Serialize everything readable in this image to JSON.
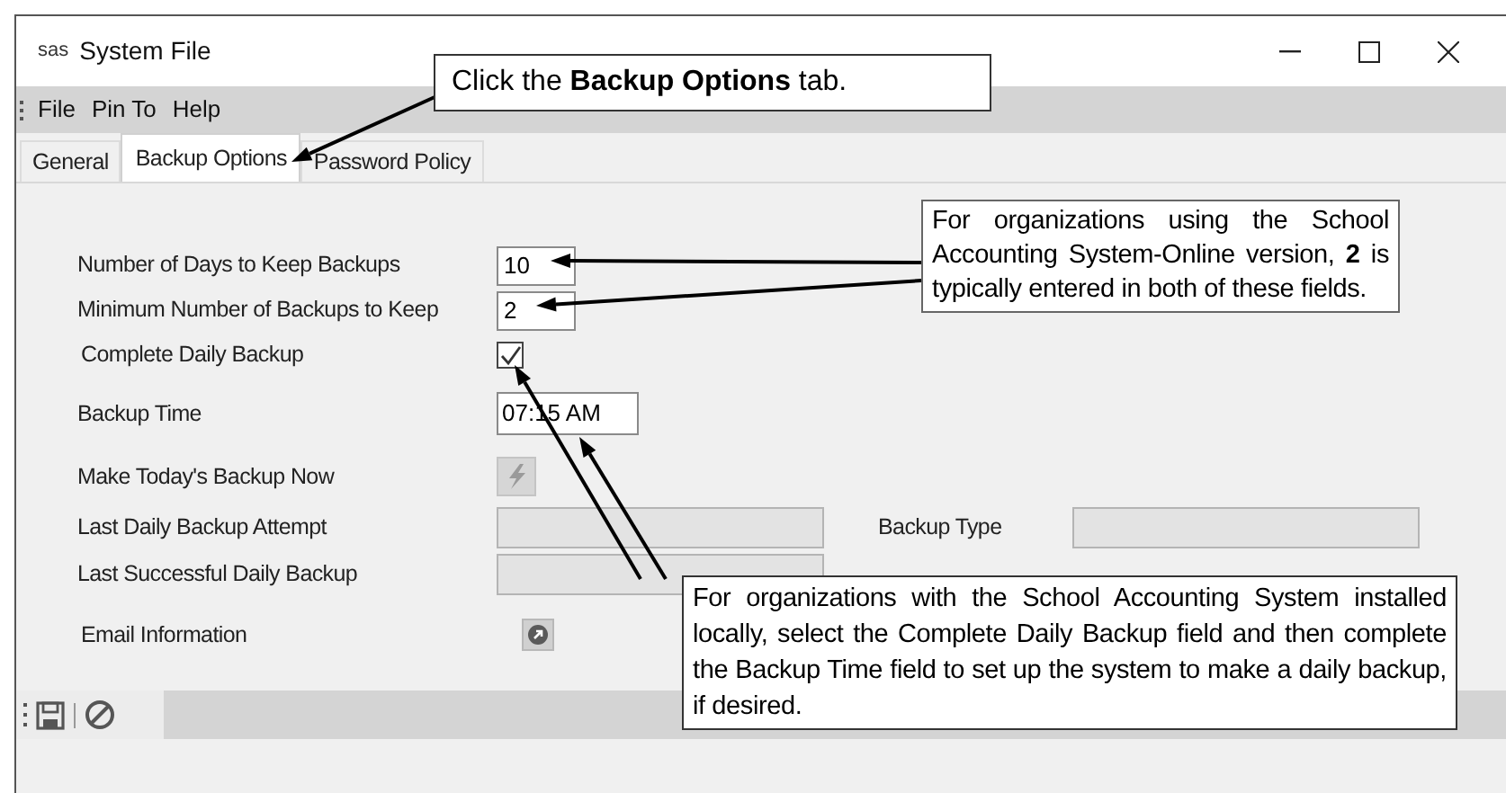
{
  "window": {
    "app_badge": "sas",
    "title": "System File"
  },
  "menu": [
    "File",
    "Pin To",
    "Help"
  ],
  "tabs": [
    {
      "label": "General",
      "selected": false
    },
    {
      "label": "Backup Options",
      "selected": true
    },
    {
      "label": "Password Policy",
      "selected": false
    }
  ],
  "fields": [
    {
      "label": "Number of Days to Keep Backups",
      "kind": "text",
      "value": "10"
    },
    {
      "label": "Minimum Number of Backups to Keep",
      "kind": "text",
      "value": "2"
    },
    {
      "label": "Complete Daily Backup",
      "kind": "checkbox",
      "checked": true
    },
    {
      "label": "Backup Time",
      "kind": "time",
      "value": "07:15 AM"
    },
    {
      "label": "Make Today's Backup Now",
      "kind": "action"
    },
    {
      "label": "Last Daily Backup Attempt",
      "kind": "readonly",
      "side_label": "Backup Type"
    },
    {
      "label": "Last Successful Daily Backup",
      "kind": "readonly"
    },
    {
      "label": "Email Information",
      "kind": "email"
    }
  ],
  "callouts": [
    "Click the **Backup Options** tab.",
    "For organizations using the School Accounting System-Online version, **2** is typically entered in both of these fields.",
    "For organizations with the School Accounting System installed locally, select the Complete Daily Backup field and then complete the Backup Time field to set up the system to make a daily backup, if desired."
  ]
}
